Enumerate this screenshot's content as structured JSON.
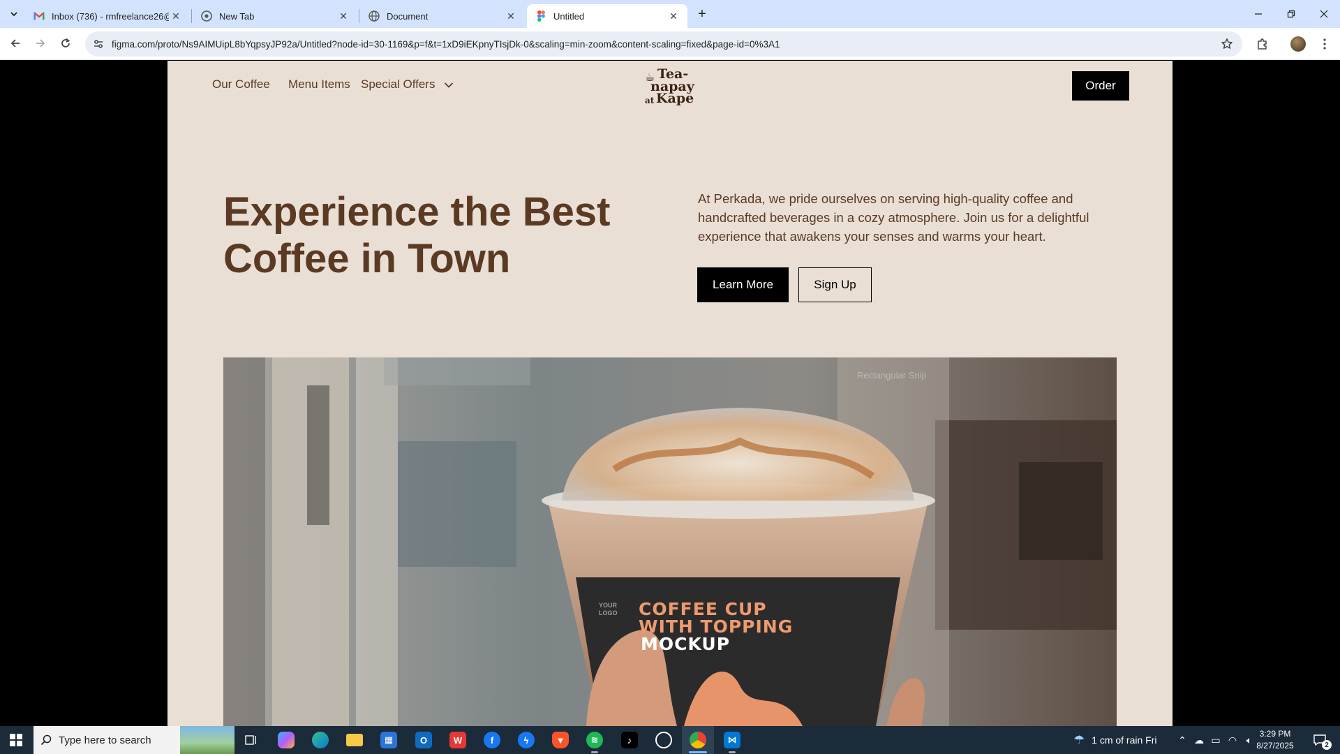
{
  "browser": {
    "tabs": [
      {
        "title": "Inbox (736) - rmfreelance26@g",
        "icon": "gmail-icon"
      },
      {
        "title": "New Tab",
        "icon": "chrome-icon"
      },
      {
        "title": "Document",
        "icon": "globe-icon"
      },
      {
        "title": "Untitled",
        "icon": "figma-icon",
        "active": true
      }
    ],
    "url": "figma.com/proto/Ns9AIMUipL8bYqpsyJP92a/Untitled?node-id=30-1169&p=f&t=1xD9iEKpnyTIsjDk-0&scaling=min-zoom&content-scaling=fixed&page-id=0%3A1"
  },
  "site": {
    "nav": {
      "links": [
        "Our Coffee",
        "Menu Items",
        "Special Offers"
      ],
      "order_label": "Order"
    },
    "logo": {
      "line1": "Tea-",
      "line2": "napay",
      "line3": "at",
      "line4": "Kape"
    },
    "hero": {
      "title": "Experience the Best Coffee in Town",
      "description": "At Perkada, we pride ourselves on serving high-quality coffee and handcrafted beverages in a cozy atmosphere. Join us for a delightful experience that awakens your senses and warms your heart.",
      "primary_button": "Learn More",
      "secondary_button": "Sign Up"
    },
    "image": {
      "cup_logo": "YOUR LOGO",
      "cup_line1": "COFFEE CUP",
      "cup_line2": "WITH TOPPING",
      "cup_line3": "MOCKUP",
      "overlay_label": "Rectangular Snip"
    }
  },
  "taskbar": {
    "search_placeholder": "Type here to search",
    "weather": "1 cm of rain Fri",
    "time": "3:29 PM",
    "date": "8/27/2025",
    "notification_count": "2"
  },
  "colors": {
    "page_background": "#e9dfd5",
    "brand_brown": "#5b3a24",
    "button_black": "#000000",
    "tab_strip": "#d3e3fd"
  }
}
